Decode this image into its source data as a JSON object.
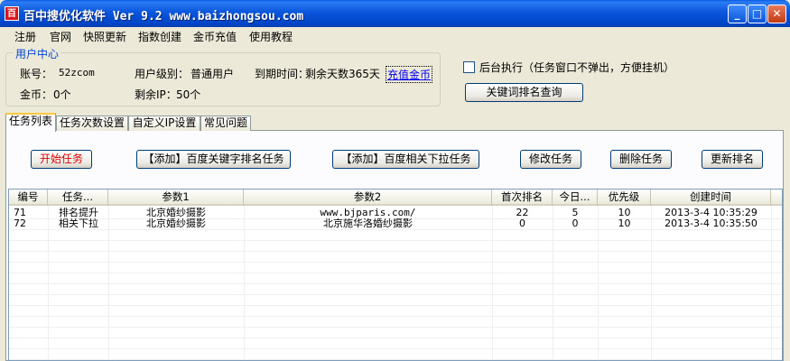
{
  "window": {
    "icon_text": "百",
    "title": "百中搜优化软件 Ver 9.2 www.baizhongsou.com",
    "min": "_",
    "max": "□",
    "close": "✕"
  },
  "menu": [
    "注册",
    "官网",
    "快照更新",
    "指数创建",
    "金币充值",
    "使用教程"
  ],
  "user_center": {
    "title": "用户中心",
    "account_label": "账号：",
    "account_value": "52zcom",
    "level_label": "用户级别：",
    "level_value": "普通用户",
    "expire_label": "到期时间：",
    "expire_value": "剩余天数365天",
    "recharge": "充值金币",
    "coins_label": "金币：",
    "coins_value": "0个",
    "ip_label": "剩余IP：",
    "ip_value": "50个"
  },
  "background_exec": {
    "label": "后台执行（任务窗口不弹出，方便挂机）",
    "checked": false
  },
  "keyword_query_button": "关键词排名查询",
  "tabs": [
    "任务列表",
    "任务次数设置",
    "自定义IP设置",
    "常见问题"
  ],
  "active_tab": 0,
  "actions": {
    "start": "开始任务",
    "add_keyword": "【添加】百度关键字排名任务",
    "add_dropdown": "【添加】百度相关下拉任务",
    "modify": "修改任务",
    "delete": "删除任务",
    "update_rank": "更新排名"
  },
  "table": {
    "headers": [
      "编号",
      "任务...",
      "参数1",
      "参数2",
      "首次排名",
      "今日...",
      "优先级",
      "创建时间"
    ],
    "rows": [
      [
        "71",
        "排名提升",
        "北京婚纱摄影",
        "www.bjparis.com/",
        "22",
        "5",
        "10",
        "2013-3-4 10:35:29"
      ],
      [
        "72",
        "相关下拉",
        "北京婚纱摄影",
        "北京施华洛婚纱摄影",
        "0",
        "0",
        "10",
        "2013-3-4 10:35:50"
      ]
    ]
  }
}
